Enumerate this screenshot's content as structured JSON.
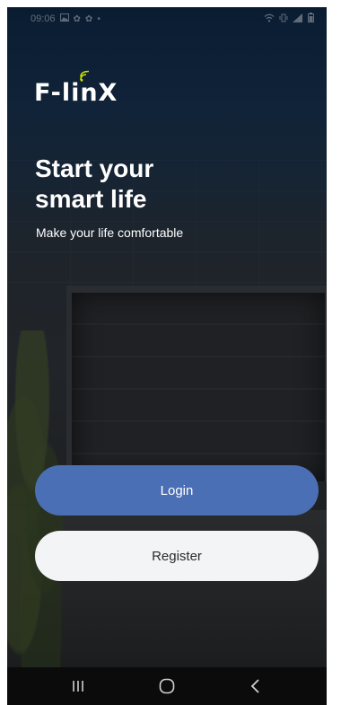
{
  "status_bar": {
    "time": "09:06",
    "left_icons": [
      "gallery-icon",
      "settings-icon",
      "settings-icon",
      "dot-icon"
    ],
    "right_icons": [
      "wifi-icon",
      "vibrate-icon",
      "signal-icon",
      "battery-icon"
    ]
  },
  "logo": {
    "text": "F-linX"
  },
  "hero": {
    "title_line1": "Start your",
    "title_line2": "smart life",
    "subtitle": "Make your life comfortable"
  },
  "buttons": {
    "login_label": "Login",
    "register_label": "Register"
  },
  "navigation": {
    "items": [
      "recent-apps-icon",
      "home-icon",
      "back-icon"
    ]
  },
  "colors": {
    "login_button": "#4a6fb5",
    "register_button": "#f3f4f5",
    "logo_accent": "#c8e000",
    "nav_background": "#0b0b0c"
  }
}
